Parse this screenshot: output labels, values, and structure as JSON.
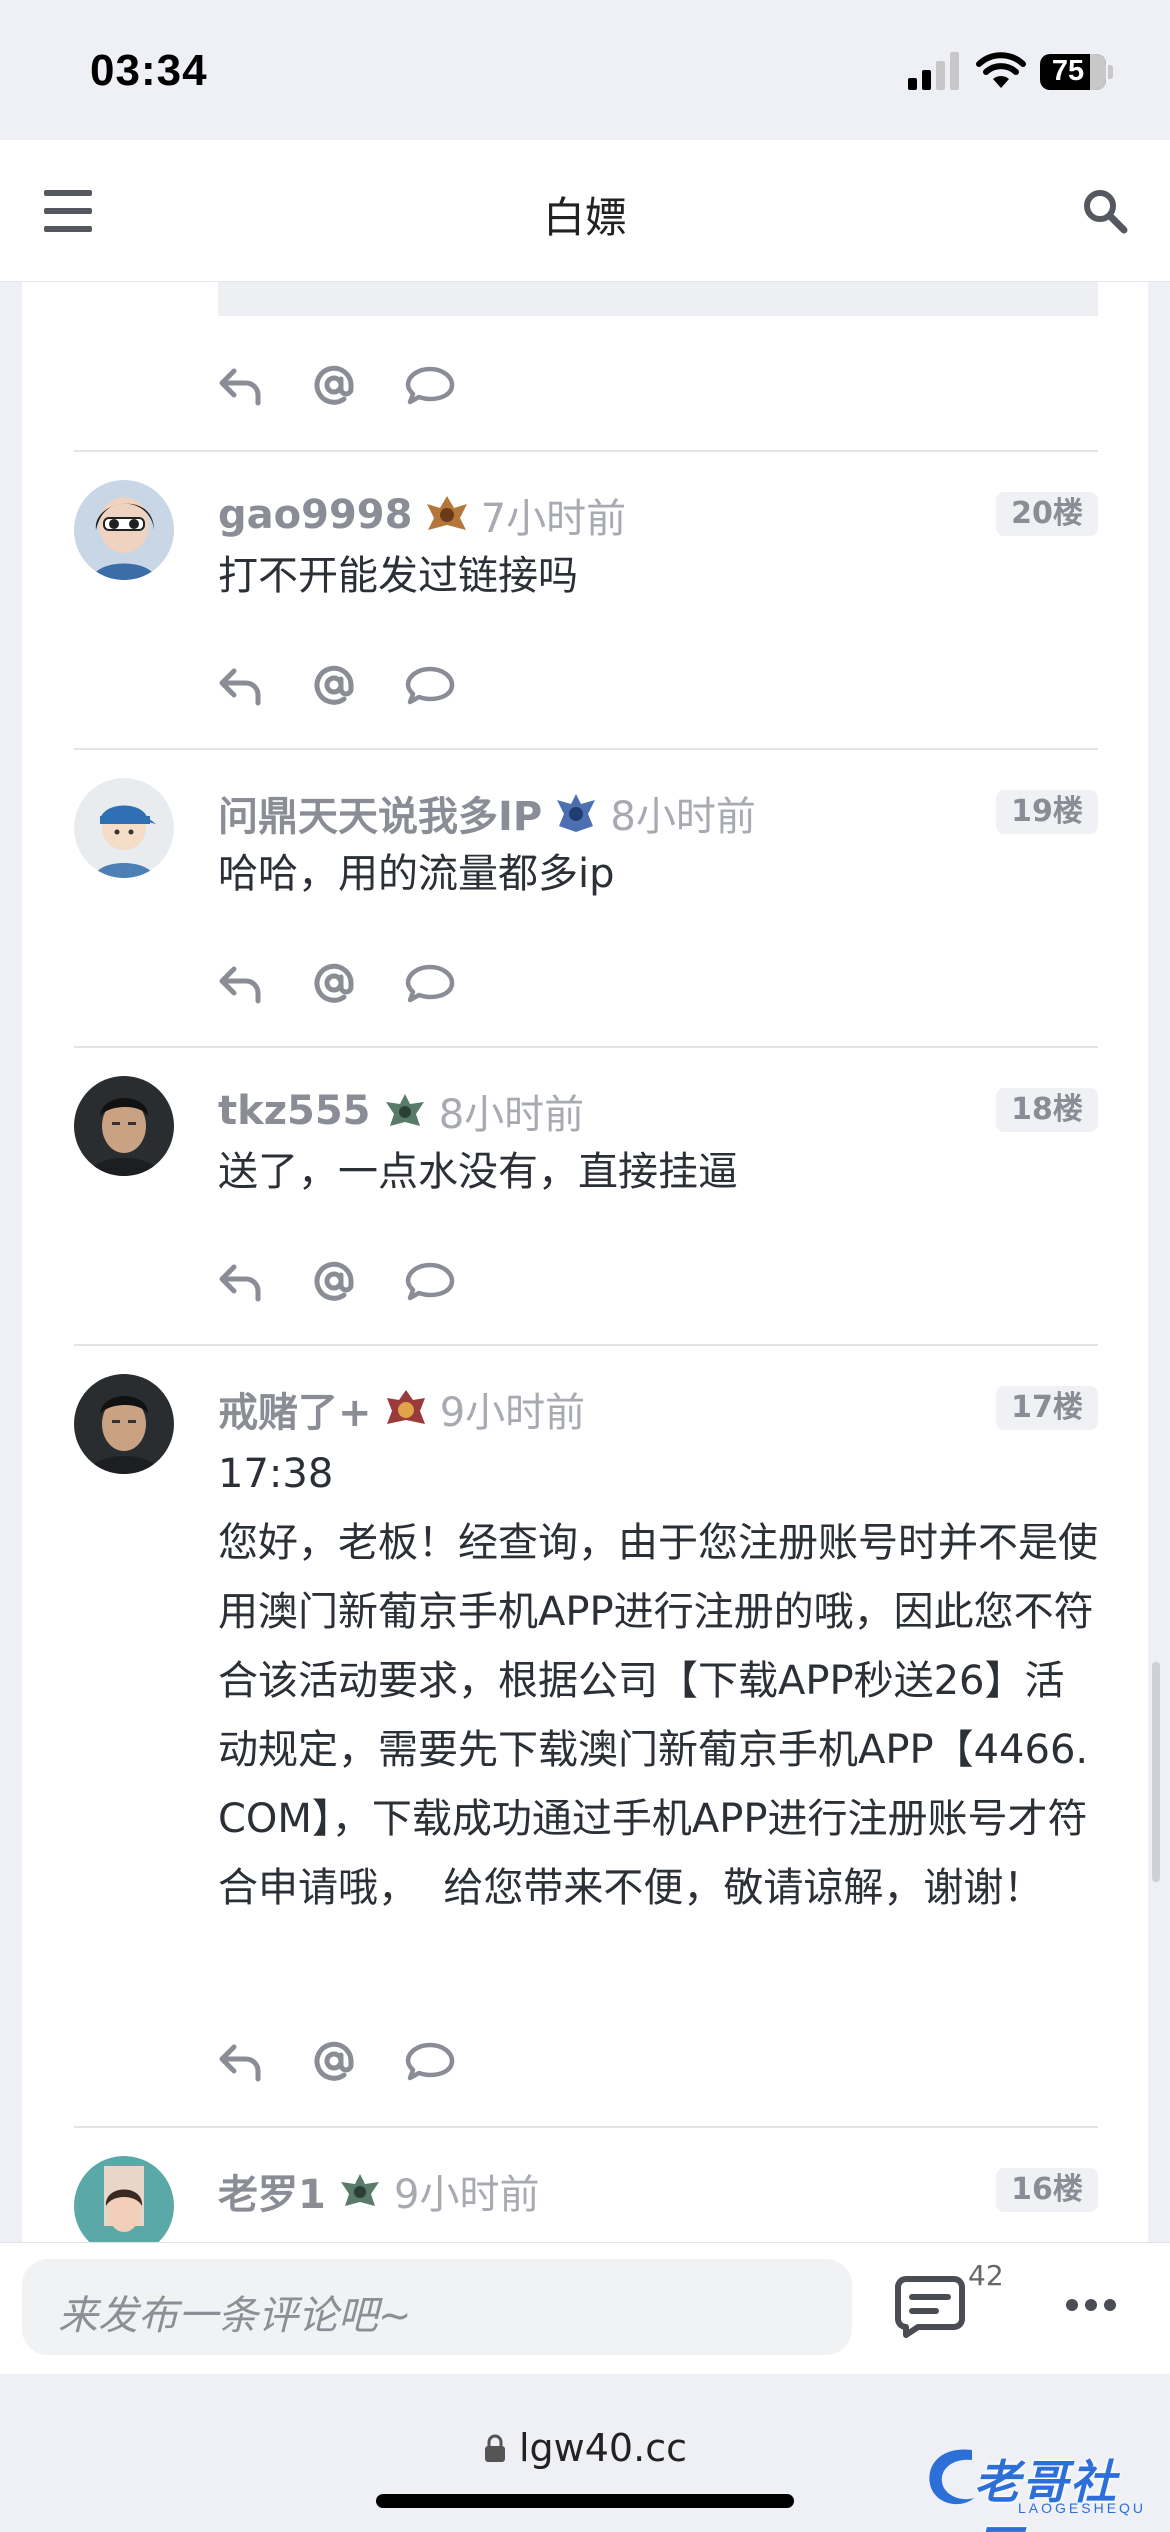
{
  "status_bar": {
    "time": "03:34",
    "battery": "75"
  },
  "header": {
    "title": "白嫖"
  },
  "comments": [
    {
      "username": "gao9998",
      "time": "7小时前",
      "floor": "20楼",
      "text": "打不开能发过链接吗"
    },
    {
      "username": "问鼎天天说我多IP",
      "time": "8小时前",
      "floor": "19楼",
      "text": "哈哈，用的流量都多ip"
    },
    {
      "username": "tkz555",
      "time": "8小时前",
      "floor": "18楼",
      "text": "送了，一点水没有，直接挂逼"
    },
    {
      "username": "戒赌了+",
      "time": "9小时前",
      "floor": "17楼",
      "text": "17:38\n您好，老板！经查询，由于您注册账号时并不是使用澳门新葡京手机APP进行注册的哦，因此您不符合该活动要求，根据公司【下载APP秒送26】活动规定，需要先下载澳门新葡京手机APP【4466.COM】，下载成功通过手机APP进行注册账号才符合申请哦，  给您带来不便，敬请谅解，谢谢！"
    },
    {
      "username": "老罗1",
      "time": "9小时前",
      "floor": "16楼",
      "text": ""
    }
  ],
  "comment_bar": {
    "placeholder": "来发布一条评论吧~",
    "comment_count": "42"
  },
  "browser": {
    "url": "lgw40.cc"
  },
  "watermark": {
    "text": "老哥社区",
    "subtext": "LAOGESHEQU"
  },
  "icons": {
    "reply": "reply-icon",
    "mention": "at-icon",
    "comment": "comment-icon",
    "more": "more-icon",
    "menu": "menu-icon",
    "search": "search-icon"
  },
  "colors": {
    "accent": "#2d6fd8",
    "muted": "#8a8d95",
    "page_bg": "#eef0f6"
  }
}
